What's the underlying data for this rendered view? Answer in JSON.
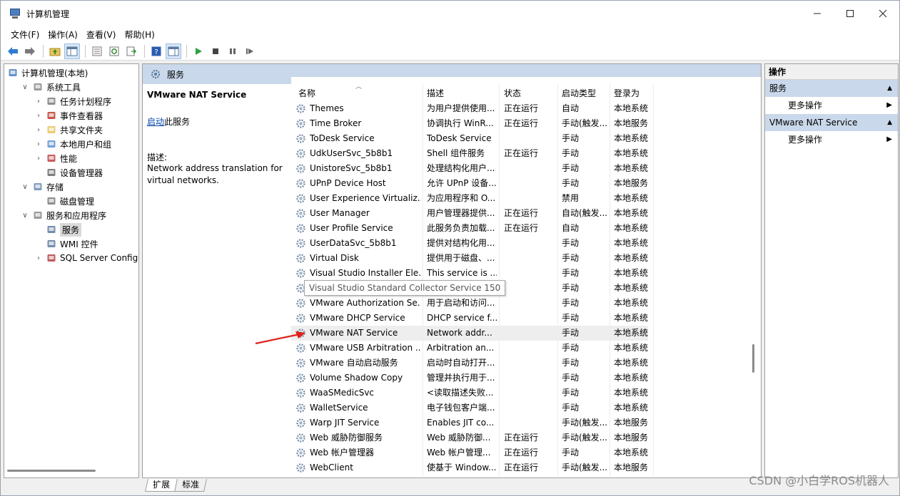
{
  "window": {
    "title": "计算机管理"
  },
  "menu": [
    "文件(F)",
    "操作(A)",
    "查看(V)",
    "帮助(H)"
  ],
  "tree": [
    {
      "label": "计算机管理(本地)",
      "level": 0,
      "expander": "",
      "icon": "computer-icon"
    },
    {
      "label": "系统工具",
      "level": 1,
      "expander": "∨",
      "icon": "tools-icon"
    },
    {
      "label": "任务计划程序",
      "level": 2,
      "expander": "›",
      "icon": "clock-icon"
    },
    {
      "label": "事件查看器",
      "level": 2,
      "expander": "›",
      "icon": "event-icon"
    },
    {
      "label": "共享文件夹",
      "level": 2,
      "expander": "›",
      "icon": "folder-icon"
    },
    {
      "label": "本地用户和组",
      "level": 2,
      "expander": "›",
      "icon": "users-icon"
    },
    {
      "label": "性能",
      "level": 2,
      "expander": "›",
      "icon": "performance-icon"
    },
    {
      "label": "设备管理器",
      "level": 2,
      "expander": "",
      "icon": "device-icon"
    },
    {
      "label": "存储",
      "level": 1,
      "expander": "∨",
      "icon": "storage-icon"
    },
    {
      "label": "磁盘管理",
      "level": 2,
      "expander": "",
      "icon": "disk-icon"
    },
    {
      "label": "服务和应用程序",
      "level": 1,
      "expander": "∨",
      "icon": "apps-icon"
    },
    {
      "label": "服务",
      "level": 2,
      "expander": "",
      "icon": "services-icon",
      "selected": true
    },
    {
      "label": "WMI 控件",
      "level": 2,
      "expander": "",
      "icon": "wmi-icon"
    },
    {
      "label": "SQL Server Configura",
      "level": 2,
      "expander": "›",
      "icon": "sql-icon"
    }
  ],
  "center": {
    "header": "服务",
    "selected_service": "VMware NAT Service",
    "start_link": "启动",
    "start_suffix": "此服务",
    "desc_label": "描述:",
    "desc_text": "Network address translation for virtual networks."
  },
  "columns": [
    "名称",
    "描述",
    "状态",
    "启动类型",
    "登录为"
  ],
  "services": [
    {
      "name": "Themes",
      "desc": "为用户提供使用...",
      "status": "正在运行",
      "startup": "自动",
      "logon": "本地系统"
    },
    {
      "name": "Time Broker",
      "desc": "协调执行 WinR...",
      "status": "正在运行",
      "startup": "手动(触发...",
      "logon": "本地服务"
    },
    {
      "name": "ToDesk Service",
      "desc": "ToDesk Service",
      "status": "",
      "startup": "手动",
      "logon": "本地系统"
    },
    {
      "name": "UdkUserSvc_5b8b1",
      "desc": "Shell 组件服务",
      "status": "正在运行",
      "startup": "手动",
      "logon": "本地系统"
    },
    {
      "name": "UnistoreSvc_5b8b1",
      "desc": "处理结构化用户...",
      "status": "",
      "startup": "手动",
      "logon": "本地系统"
    },
    {
      "name": "UPnP Device Host",
      "desc": "允许 UPnP 设备...",
      "status": "",
      "startup": "手动",
      "logon": "本地服务"
    },
    {
      "name": "User Experience Virtualiz...",
      "desc": "为应用程序和 O...",
      "status": "",
      "startup": "禁用",
      "logon": "本地系统"
    },
    {
      "name": "User Manager",
      "desc": "用户管理器提供...",
      "status": "正在运行",
      "startup": "自动(触发...",
      "logon": "本地系统"
    },
    {
      "name": "User Profile Service",
      "desc": "此服务负责加载...",
      "status": "正在运行",
      "startup": "自动",
      "logon": "本地系统"
    },
    {
      "name": "UserDataSvc_5b8b1",
      "desc": "提供对结构化用...",
      "status": "",
      "startup": "手动",
      "logon": "本地系统"
    },
    {
      "name": "Virtual Disk",
      "desc": "提供用于磁盘、...",
      "status": "",
      "startup": "手动",
      "logon": "本地系统"
    },
    {
      "name": "Visual Studio Installer Ele...",
      "desc": "This service is ...",
      "status": "",
      "startup": "手动",
      "logon": "本地系统"
    },
    {
      "name": "Visual Studio Standard Collector Service 150",
      "desc": "",
      "status": "",
      "startup": "手动",
      "logon": "本地系统"
    },
    {
      "name": "VMware Authorization Se...",
      "desc": "用于启动和访问...",
      "status": "",
      "startup": "手动",
      "logon": "本地系统"
    },
    {
      "name": "VMware DHCP Service",
      "desc": "DHCP service f...",
      "status": "",
      "startup": "手动",
      "logon": "本地系统"
    },
    {
      "name": "VMware NAT Service",
      "desc": "Network addr...",
      "status": "",
      "startup": "手动",
      "logon": "本地系统",
      "selected": true
    },
    {
      "name": "VMware USB Arbitration ...",
      "desc": "Arbitration an...",
      "status": "",
      "startup": "手动",
      "logon": "本地系统"
    },
    {
      "name": "VMware 自动启动服务",
      "desc": "启动时自动打开...",
      "status": "",
      "startup": "手动",
      "logon": "本地系统"
    },
    {
      "name": "Volume Shadow Copy",
      "desc": "管理并执行用于...",
      "status": "",
      "startup": "手动",
      "logon": "本地系统"
    },
    {
      "name": "WaaSMedicSvc",
      "desc": "<读取描述失败...",
      "status": "",
      "startup": "手动",
      "logon": "本地系统"
    },
    {
      "name": "WalletService",
      "desc": "电子钱包客户端...",
      "status": "",
      "startup": "手动",
      "logon": "本地系统"
    },
    {
      "name": "Warp JIT Service",
      "desc": "Enables JIT co...",
      "status": "",
      "startup": "手动(触发...",
      "logon": "本地服务"
    },
    {
      "name": "Web 威胁防御服务",
      "desc": "Web 威胁防御...",
      "status": "正在运行",
      "startup": "手动(触发...",
      "logon": "本地服务"
    },
    {
      "name": "Web 帐户管理器",
      "desc": "Web 帐户管理...",
      "status": "正在运行",
      "startup": "手动",
      "logon": "本地系统"
    },
    {
      "name": "WebClient",
      "desc": "使基于 Window...",
      "status": "正在运行",
      "startup": "手动(触发...",
      "logon": "本地服务"
    }
  ],
  "tooltip": "Visual Studio Standard Collector Service 150",
  "bottom_tabs": [
    "扩展",
    "标准"
  ],
  "actions": {
    "header": "操作",
    "sections": [
      {
        "title": "服务",
        "item": "更多操作"
      },
      {
        "title": "VMware NAT Service",
        "item": "更多操作"
      }
    ]
  },
  "watermark": "CSDN @小白学ROS机器人",
  "colors": {
    "header_blue": "#c9d8ea",
    "link_blue": "#0645ad",
    "arrow_red": "#e0201b"
  }
}
